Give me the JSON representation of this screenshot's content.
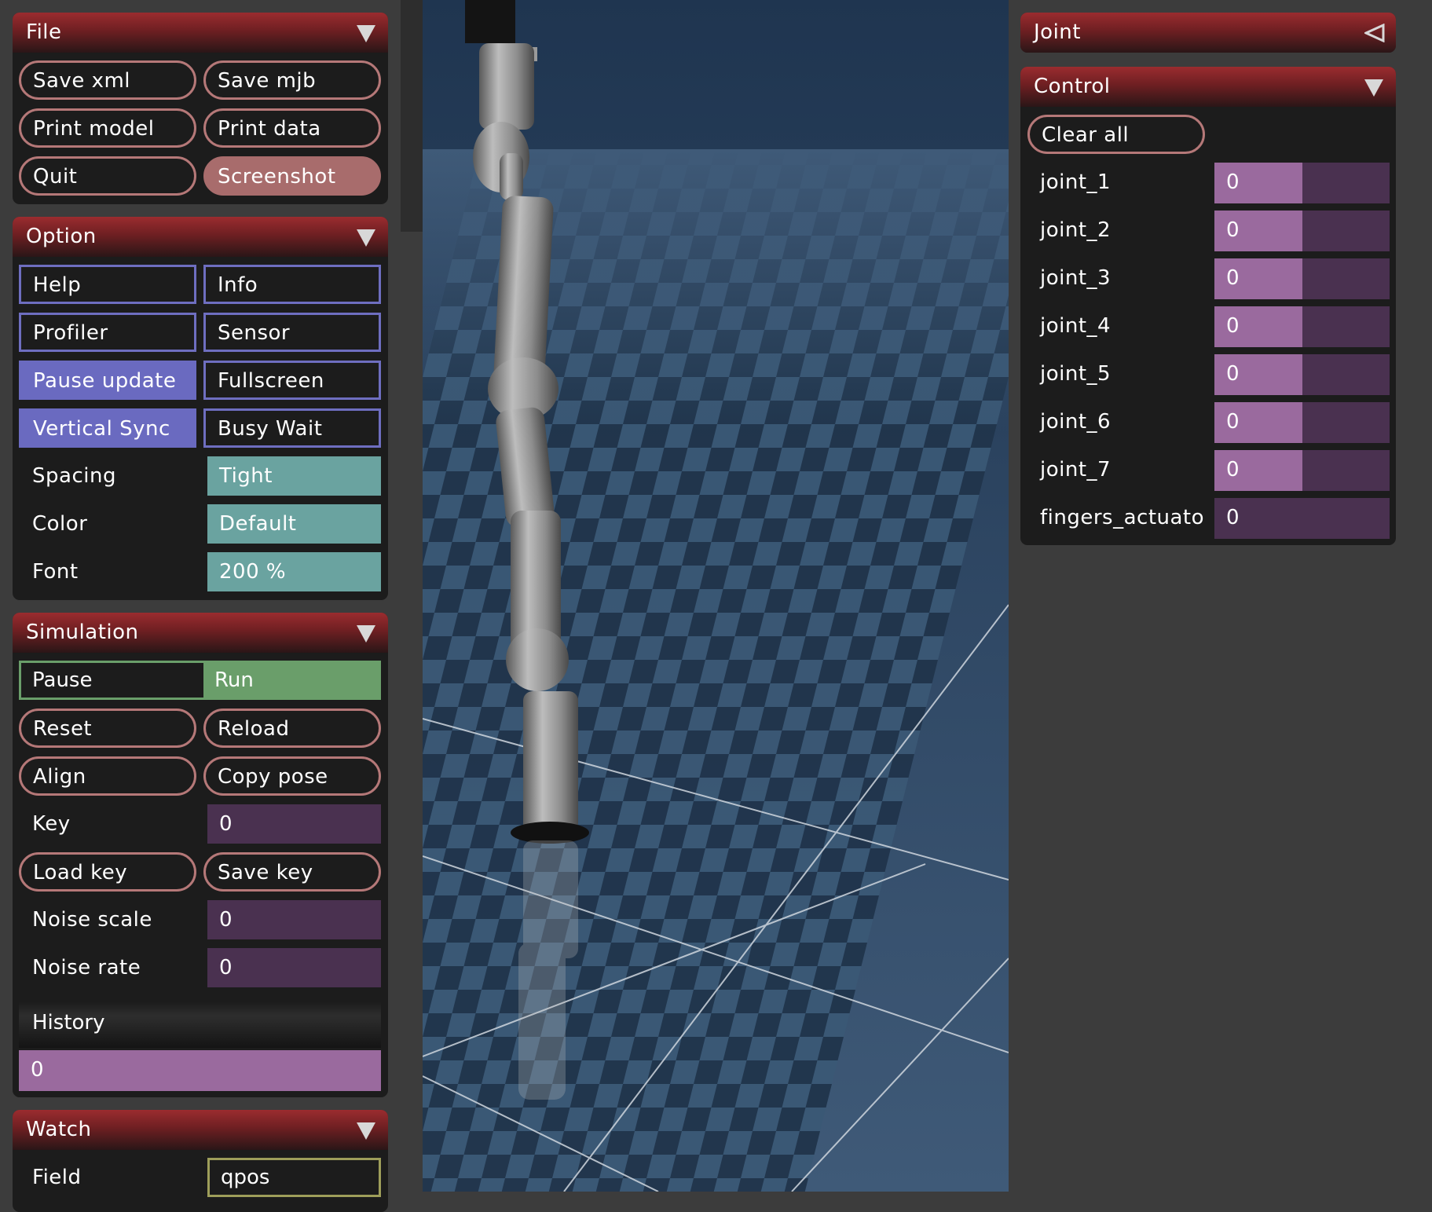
{
  "file_panel": {
    "title": "File",
    "buttons": [
      "Save xml",
      "Save mjb",
      "Print model",
      "Print data",
      "Quit",
      "Screenshot"
    ]
  },
  "option_panel": {
    "title": "Option",
    "toggles": [
      "Help",
      "Info",
      "Profiler",
      "Sensor",
      "Pause update",
      "Fullscreen",
      "Vertical Sync",
      "Busy Wait"
    ],
    "spacing_label": "Spacing",
    "spacing_value": "Tight",
    "color_label": "Color",
    "color_value": "Default",
    "font_label": "Font",
    "font_value": "200 %"
  },
  "simulation_panel": {
    "title": "Simulation",
    "pause_label": "Pause",
    "run_label": "Run",
    "buttons": [
      "Reset",
      "Reload",
      "Align",
      "Copy pose"
    ],
    "key_label": "Key",
    "key_value": "0",
    "load_key": "Load key",
    "save_key": "Save key",
    "noise_scale_label": "Noise scale",
    "noise_scale_value": "0",
    "noise_rate_label": "Noise rate",
    "noise_rate_value": "0",
    "history_label": "History",
    "history_value": "0"
  },
  "watch_panel": {
    "title": "Watch",
    "field_label": "Field",
    "field_value": "qpos"
  },
  "joint_panel": {
    "title": "Joint"
  },
  "control_panel": {
    "title": "Control",
    "clear_all": "Clear all",
    "joints": [
      {
        "name": "joint_1",
        "value": "0",
        "fill": 0.5
      },
      {
        "name": "joint_2",
        "value": "0",
        "fill": 0.5
      },
      {
        "name": "joint_3",
        "value": "0",
        "fill": 0.5
      },
      {
        "name": "joint_4",
        "value": "0",
        "fill": 0.5
      },
      {
        "name": "joint_5",
        "value": "0",
        "fill": 0.5
      },
      {
        "name": "joint_6",
        "value": "0",
        "fill": 0.5
      },
      {
        "name": "joint_7",
        "value": "0",
        "fill": 0.5
      },
      {
        "name": "fingers_actuato",
        "value": "0",
        "fill": 0.0
      }
    ]
  },
  "colors": {
    "header_red": "#9b2c2f",
    "panel_bg": "#1c1c1c",
    "pill_border": "#b57878",
    "toggle_blue": "#6a6ac0",
    "select_teal": "#6aa3a0",
    "slider_purple": "#9a6a9e",
    "run_green": "#6a9e6a",
    "floor_blue": "#3a5672"
  }
}
